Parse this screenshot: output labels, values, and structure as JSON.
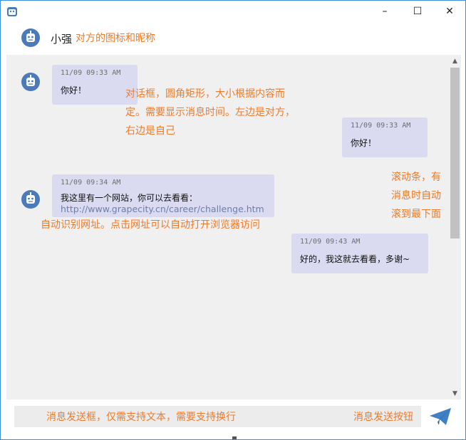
{
  "window": {
    "app_icon": "robot-avatar-icon",
    "controls": {
      "minimize": "–",
      "maximize": "☐",
      "close": "✕"
    }
  },
  "header": {
    "peer_name": "小强",
    "note": "对方的图标和昵称"
  },
  "annotations": {
    "bubble_note_line1": "对话框，圆角矩形，大小根据内容而",
    "bubble_note_line2": "定。需要显示消息时间。左边是对方，",
    "bubble_note_line3": "右边是自己",
    "scroll_note_line1": "滚动条，有",
    "scroll_note_line2": "消息时自动",
    "scroll_note_line3": "滚到最下面",
    "url_note": "自动识别网址。点击网址可以自动打开浏览器访问",
    "composer_note": "消息发送框，仅需支持文本，需要支持换行",
    "send_note": "消息发送按钮"
  },
  "messages": [
    {
      "side": "left",
      "time": "11/09 09:33 AM",
      "text": "你好！"
    },
    {
      "side": "right",
      "time": "11/09 09:33 AM",
      "text": "你好！"
    },
    {
      "side": "left",
      "time": "11/09 09:34 AM",
      "text": "我这里有一个网站，你可以去看看：",
      "link": "http://www.grapecity.cn/career/challenge.htm"
    },
    {
      "side": "right",
      "time": "11/09 09:43 AM",
      "text": "好的，我这就去看看，多谢~"
    }
  ],
  "colors": {
    "annotation": "#f07a2a",
    "bubble": "#dadbf0",
    "link": "#6a7fb0",
    "avatar": "#4a7ab8",
    "send": "#3f7fc4"
  }
}
